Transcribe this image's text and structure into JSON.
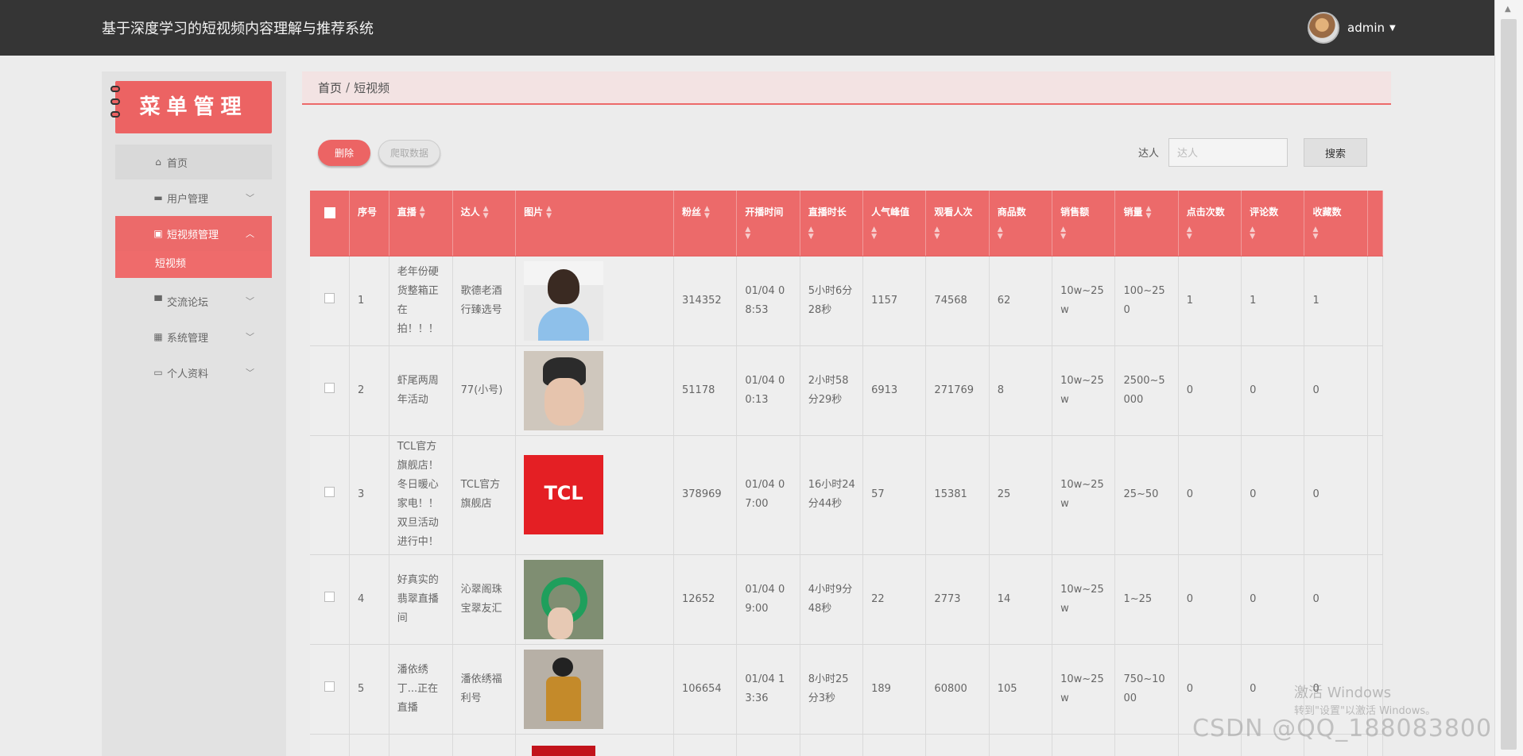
{
  "app": {
    "title": "基于深度学习的短视频内容理解与推荐系统",
    "user": "admin"
  },
  "sidebar": {
    "banner": "菜单管理",
    "items": [
      {
        "label": "首页",
        "icon": "home-icon"
      },
      {
        "label": "用户管理",
        "icon": "user-icon"
      },
      {
        "label": "短视频管理",
        "icon": "video-icon"
      },
      {
        "label": "交流论坛",
        "icon": "chat-icon"
      },
      {
        "label": "系统管理",
        "icon": "grid-icon"
      },
      {
        "label": "个人资料",
        "icon": "profile-icon"
      }
    ],
    "subitem": "短视频"
  },
  "breadcrumb": {
    "home": "首页",
    "current": "短视频"
  },
  "toolbar": {
    "delete": "删除",
    "crawl": "爬取数据",
    "search_label": "达人",
    "search_placeholder": "达人",
    "search_button": "搜索"
  },
  "table": {
    "headers": [
      "序号",
      "直播",
      "达人",
      "图片",
      "粉丝",
      "开播时间",
      "直播时长",
      "人气峰值",
      "观看人次",
      "商品数",
      "销售额",
      "销量",
      "点击次数",
      "评论数",
      "收藏数"
    ],
    "rows": [
      [
        "1",
        "老年份硬货整箱正在拍！！！",
        "歌德老酒行臻选号",
        "",
        "314352",
        "01/04 08:53",
        "5小时6分28秒",
        "1157",
        "74568",
        "62",
        "10w~25w",
        "100~250",
        "1",
        "1",
        "1"
      ],
      [
        "2",
        "虾尾两周年活动",
        "77(小号)",
        "",
        "51178",
        "01/04 00:13",
        "2小时58分29秒",
        "6913",
        "271769",
        "8",
        "10w~25w",
        "2500~5000",
        "0",
        "0",
        "0"
      ],
      [
        "3",
        "TCL官方旗舰店！冬日暖心家电！！双旦活动进行中！",
        "TCL官方旗舰店",
        "TCL",
        "378969",
        "01/04 07:00",
        "16小时24分44秒",
        "57",
        "15381",
        "25",
        "10w~25w",
        "25~50",
        "0",
        "0",
        "0"
      ],
      [
        "4",
        "好真实的翡翠直播间",
        "沁翠阁珠宝翠友汇",
        "",
        "12652",
        "01/04 09:00",
        "4小时9分48秒",
        "22",
        "2773",
        "14",
        "10w~25w",
        "1~25",
        "0",
        "0",
        "0"
      ],
      [
        "5",
        "潘依绣丁...正在直播",
        "潘依绣福利号",
        "",
        "106654",
        "01/04 13:36",
        "8小时25分3秒",
        "189",
        "60800",
        "105",
        "10w~25w",
        "750~1000",
        "0",
        "0",
        "0"
      ]
    ]
  },
  "watermark": {
    "line1": "激活 Windows",
    "line2": "转到\"设置\"以激活 Windows。",
    "csdn": "CSDN @QQ_188083800"
  }
}
